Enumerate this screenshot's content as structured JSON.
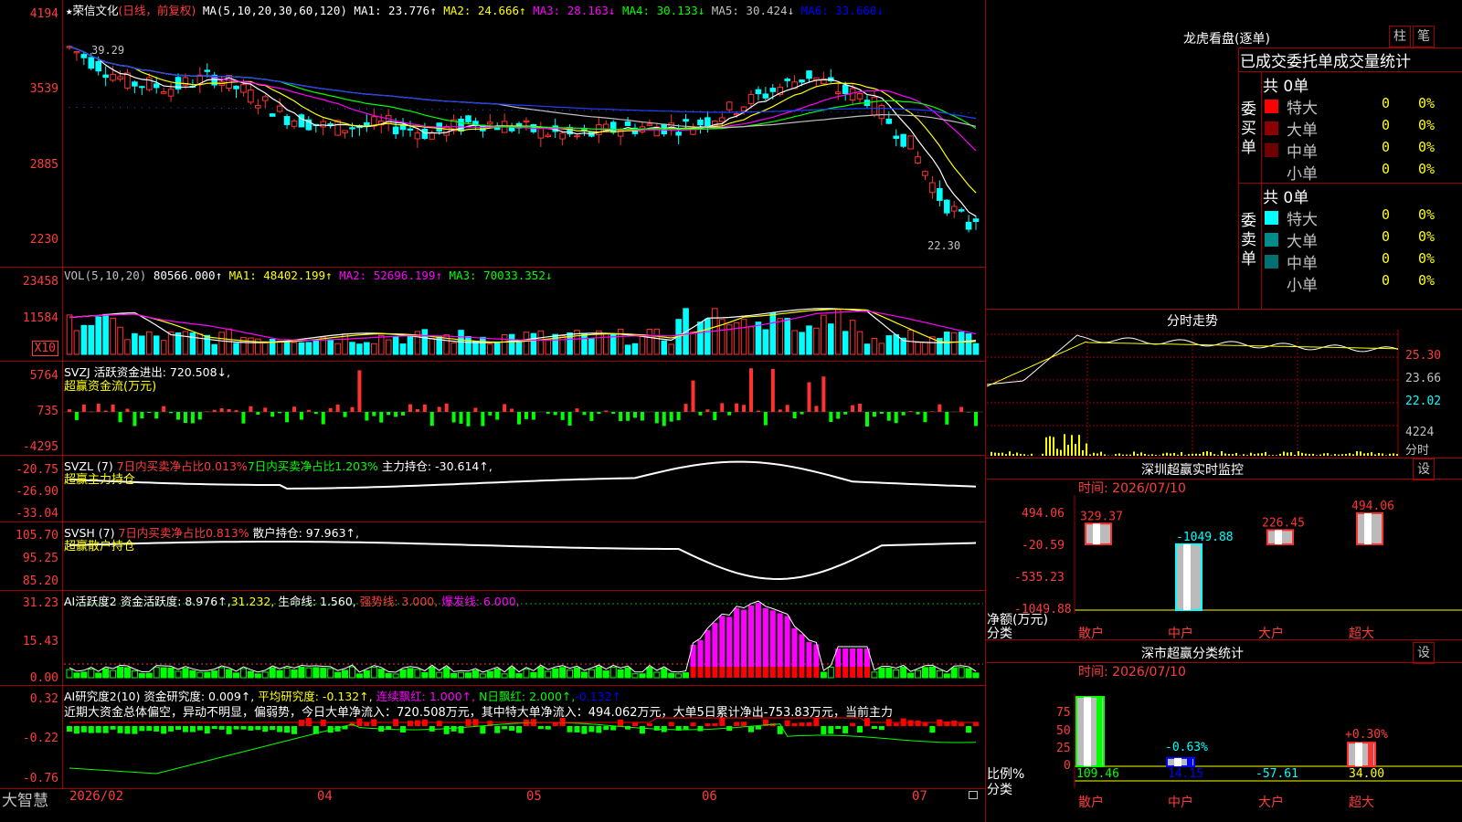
{
  "stock": {
    "name": "荣信文化",
    "period": "(日线，前复权)",
    "star": "★"
  },
  "ma_header": {
    "params": "MA(5,10,20,30,60,120)",
    "ma1": "MA1: 23.776↑",
    "ma2": "MA2: 24.666↑",
    "ma3": "MA3: 28.163↓",
    "ma4": "MA4: 30.133↓",
    "ma5": "MA5: 30.424↓",
    "ma6": "MA6: 33.660↓"
  },
  "price_axis": [
    "4194",
    "3539",
    "2885",
    "2230"
  ],
  "price_notes": {
    "high": "39.29",
    "low": "22.30"
  },
  "vol_header": {
    "params": "VOL(5,10,20)",
    "val": "80566.000↑",
    "ma1": "MA1: 48402.199↑",
    "ma2": "MA2: 52696.199↑",
    "ma3": "MA3: 70033.352↓"
  },
  "vol_axis": [
    "23458",
    "11584"
  ],
  "vol_unit": "X10",
  "svzj": {
    "header": "SVZJ  活跃资金进出: 720.508↓,",
    "sub": "超赢资金流(万元)",
    "axis": [
      "5764",
      "735",
      "-4295"
    ]
  },
  "svzl": {
    "h1": "SVZL (7)",
    "h2": "7日内买卖净占比0.013%",
    "h3": "7日内买卖净占比1.203%",
    "h4": "主力持仓: -30.614↑,",
    "sub": "超赢主力持仓",
    "axis": [
      "-20.75",
      "-26.90",
      "-33.04"
    ]
  },
  "svsh": {
    "h1": "SVSH (7)",
    "h2": "7日内买卖净占比0.813%",
    "h3": "散户持仓: 97.963↑,",
    "sub": "超赢散户持仓",
    "axis": [
      "105.70",
      "95.25",
      "85.20"
    ]
  },
  "ai1": {
    "h1": "AI活跃度2",
    "h2": "资金活跃度: 8.976↑,",
    "h3": "31.232,",
    "h4": "生命线: 1.560,",
    "h5": "强势线: 3.000,",
    "h6": "爆发线: 6.000,",
    "axis": [
      "31.23",
      "15.43",
      "0.00"
    ]
  },
  "ai2": {
    "h1": "AI研究度2(10)",
    "h2": "资金研究度: 0.009↑,",
    "h3": "平均研究度: -0.132↑,",
    "h4": "连续飘红: 1.000↑,",
    "h5": "N日飘红: 2.000↑,",
    "h6": "-0.132↑",
    "comment": "近期大资金总体偏空，异动不明显，偏弱势，今日大单净流入：720.508万元，其中特大单净流入：494.062万元，大单5日累计净出-753.83万元，当前主力",
    "axis": [
      "0.32",
      "-0.22",
      "-0.76"
    ]
  },
  "xaxis": {
    "brand": "大智慧",
    "labels": [
      "2026/02",
      "04",
      "05",
      "06",
      "07"
    ]
  },
  "longhu": {
    "title": "龙虎看盘(逐单)",
    "btn_bar": "柱",
    "btn_pen": "笔",
    "tabs": "已成交委托单成交量统计",
    "buy": {
      "label": "委买单",
      "total": "共 0单",
      "rows": [
        {
          "name": "特大",
          "v1": "0",
          "v2": "0%"
        },
        {
          "name": "大单",
          "v1": "0",
          "v2": "0%"
        },
        {
          "name": "中单",
          "v1": "0",
          "v2": "0%"
        },
        {
          "name": "小单",
          "v1": "0",
          "v2": "0%"
        }
      ]
    },
    "sell": {
      "label": "委卖单",
      "total": "共 0单",
      "rows": [
        {
          "name": "特大",
          "v1": "0",
          "v2": "0%"
        },
        {
          "name": "大单",
          "v1": "0",
          "v2": "0%"
        },
        {
          "name": "中单",
          "v1": "0",
          "v2": "0%"
        },
        {
          "name": "小单",
          "v1": "0",
          "v2": "0%"
        }
      ]
    },
    "colors": {
      "buy": [
        "#ff0000",
        "#8b0000",
        "#700000",
        "#000000"
      ],
      "sell": [
        "#00ffff",
        "#008b8b",
        "#007070",
        "#000000"
      ]
    }
  },
  "fenshi": {
    "title": "分时走势",
    "axis": [
      "25.30",
      "23.66",
      "22.02",
      "4224"
    ],
    "unit": "分时"
  },
  "sz_monitor": {
    "title": "深圳超赢实时监控",
    "time": "时间: 2026/07/10",
    "btn": "设",
    "axis": [
      "494.06",
      "-20.59",
      "-535.23",
      "-1049.88"
    ],
    "ylabel": "净额(万元)",
    "xlabel": "分类",
    "cats": [
      "散户",
      "中户",
      "大户",
      "超大"
    ],
    "chart_data": {
      "type": "bar",
      "categories": [
        "散户",
        "中户",
        "大户",
        "超大"
      ],
      "values": [
        329.37,
        -1049.88,
        226.45,
        494.06
      ],
      "ylabel": "净额(万元)",
      "ylim": [
        -1049.88,
        494.06
      ]
    }
  },
  "sz_class": {
    "title": "深市超赢分类统计",
    "time": "时间: 2026/07/10",
    "btn": "设",
    "axis": [
      "75",
      "50",
      "25",
      "0"
    ],
    "ylabel": "比例%",
    "xlabel": "分类",
    "cats": [
      "散户",
      "中户",
      "大户",
      "超大"
    ],
    "top_labels": [
      "",
      "-0.63%",
      "",
      "+0.30%"
    ],
    "bottom_labels": [
      "109.46",
      "14.15",
      "-57.61",
      "34.00"
    ],
    "chart_data": {
      "type": "bar",
      "categories": [
        "散户",
        "中户",
        "大户",
        "超大"
      ],
      "values": [
        100,
        12,
        0,
        34
      ],
      "ylabel": "比例%",
      "ylim": [
        0,
        100
      ]
    }
  }
}
